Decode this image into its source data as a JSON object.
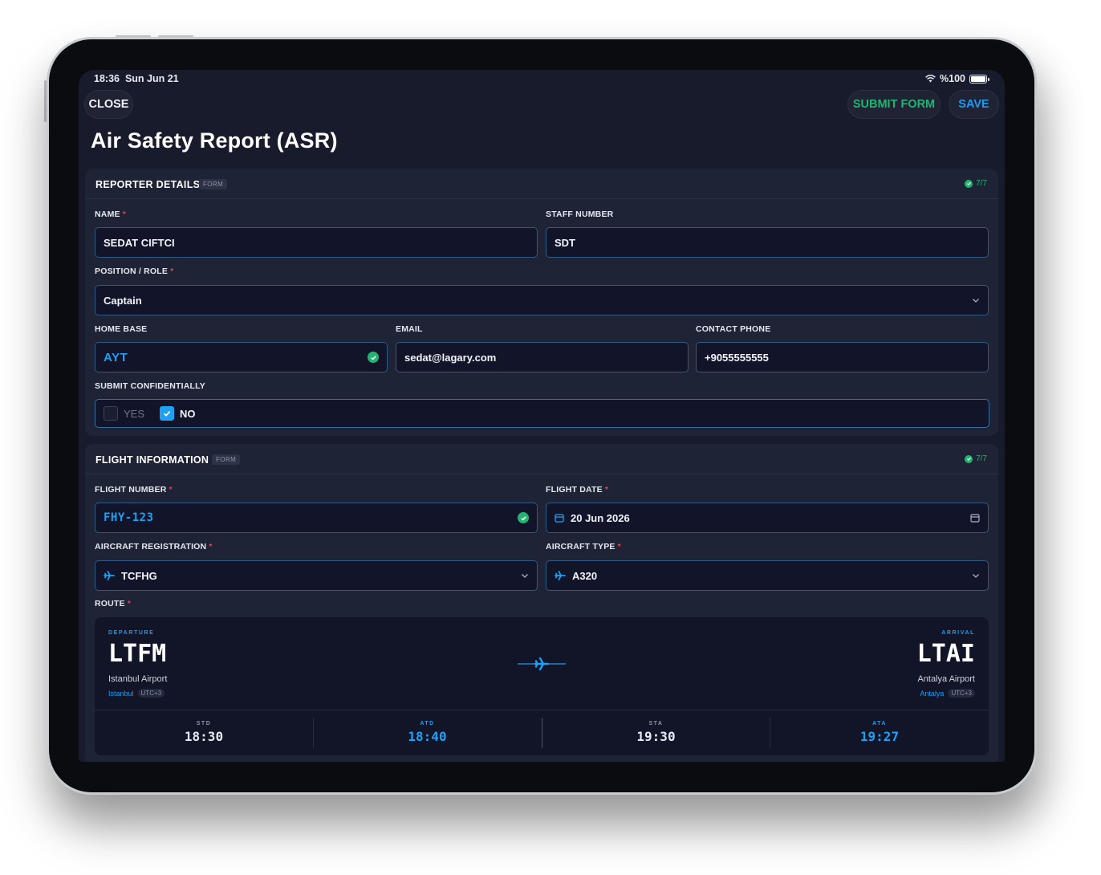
{
  "status_bar": {
    "time": "18:36",
    "date": "Sun Jun 21",
    "battery": "%100"
  },
  "header": {
    "close_label": "CLOSE",
    "submit_label": "SUBMIT FORM",
    "save_label": "SAVE"
  },
  "title": "Air Safety Report (ASR)",
  "reporter": {
    "title": "REPORTER DETAILS",
    "tag": "FORM",
    "progress": "7/7",
    "name_label": "NAME",
    "name_value": "SEDAT CIFTCI",
    "staff_label": "STAFF NUMBER",
    "staff_value": "SDT",
    "position_label": "POSITION / ROLE",
    "position_value": "Captain",
    "home_label": "HOME BASE",
    "home_value": "AYT",
    "email_label": "EMAIL",
    "email_value": "sedat@lagary.com",
    "phone_label": "CONTACT PHONE",
    "phone_value": "+9055555555",
    "confidential_label": "SUBMIT CONFIDENTIALLY",
    "yes_label": "YES",
    "no_label": "NO",
    "confidential_selected": "NO"
  },
  "flight": {
    "title": "FLIGHT INFORMATION",
    "tag": "FORM",
    "progress": "7/7",
    "number_label": "FLIGHT NUMBER",
    "number_value": "FHY-123",
    "date_label": "FLIGHT DATE",
    "date_value": "20 Jun 2026",
    "reg_label": "AIRCRAFT REGISTRATION",
    "reg_value": "TCFHG",
    "type_label": "AIRCRAFT TYPE",
    "type_value": "A320",
    "route_label": "ROUTE",
    "route": {
      "departure_label": "DEPARTURE",
      "departure_code": "LTFM",
      "departure_airport": "Istanbul Airport",
      "departure_city": "Istanbul",
      "departure_utc": "UTC+3",
      "arrival_label": "ARRIVAL",
      "arrival_code": "LTAI",
      "arrival_airport": "Antalya Airport",
      "arrival_city": "Antalya",
      "arrival_utc": "UTC+3"
    },
    "times": [
      {
        "label": "STD",
        "value": "18:30"
      },
      {
        "label": "ATD",
        "value": "18:40"
      },
      {
        "label": "STA",
        "value": "19:30"
      },
      {
        "label": "ATA",
        "value": "19:27"
      }
    ]
  },
  "colors": {
    "accent": "#1ea0f4",
    "success": "#22b56f",
    "required": "#e0434f",
    "background": "#181b2b"
  }
}
